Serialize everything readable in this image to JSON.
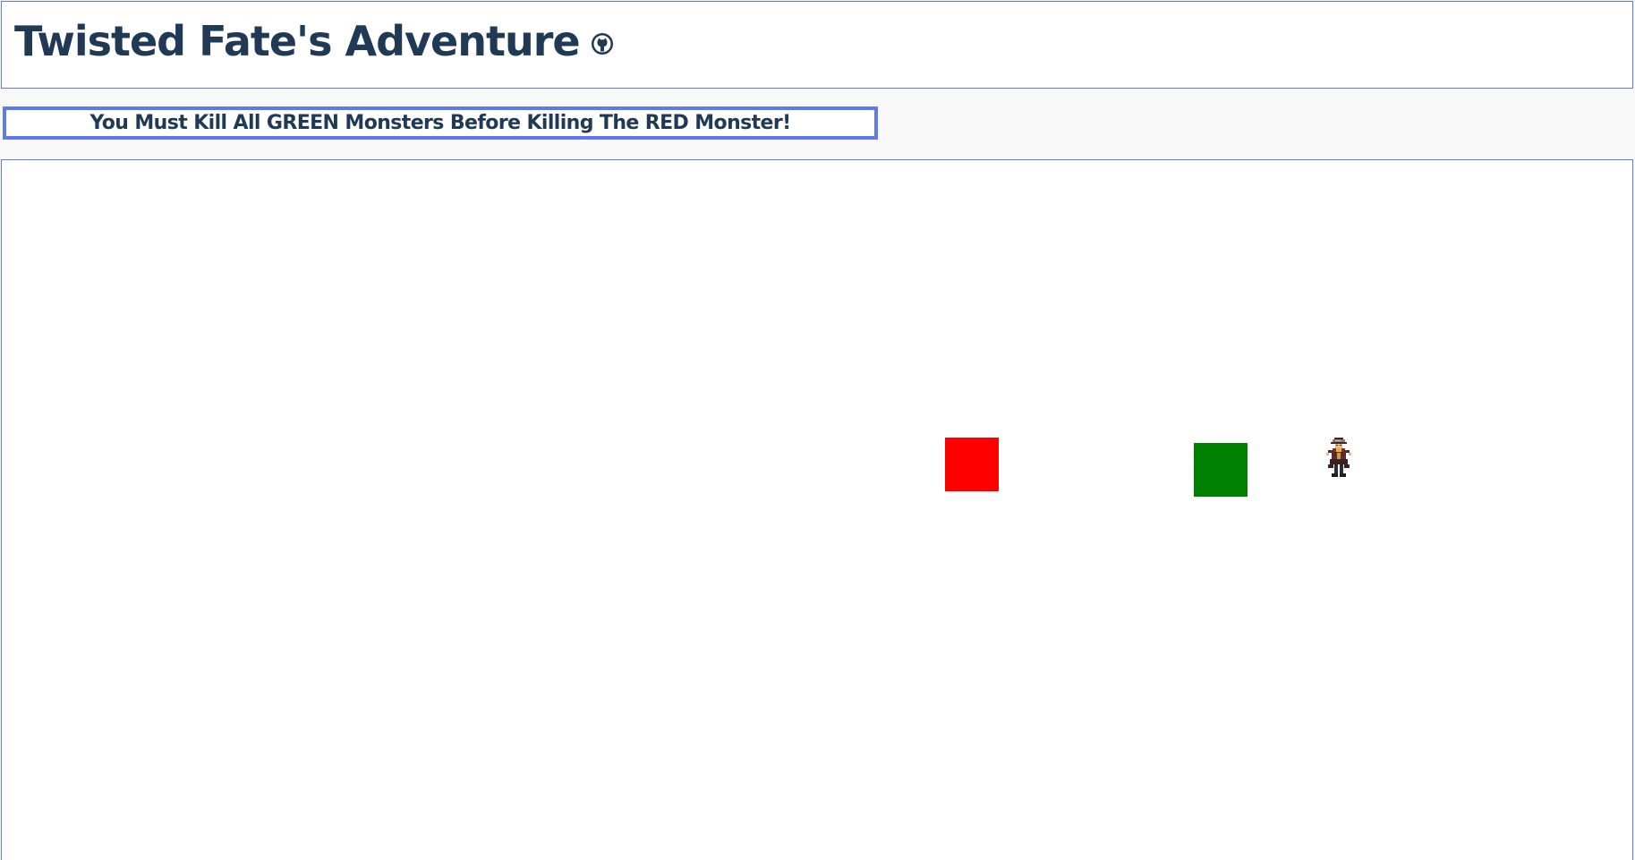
{
  "header": {
    "title": "Twisted Fate's Adventure",
    "link_icon": "github-icon"
  },
  "status": {
    "message": "You Must Kill All GREEN Monsters Before Killing The RED Monster!"
  },
  "game": {
    "monsters": [
      {
        "kind": "red-monster",
        "color": "#ff0000"
      },
      {
        "kind": "green-monster",
        "color": "#008000"
      }
    ],
    "player": {
      "name": "twisted-fate-sprite"
    }
  },
  "colors": {
    "accent_border": "#5f79ee",
    "text": "#203a55",
    "red_monster": "#ff0000",
    "green_monster": "#008000"
  }
}
